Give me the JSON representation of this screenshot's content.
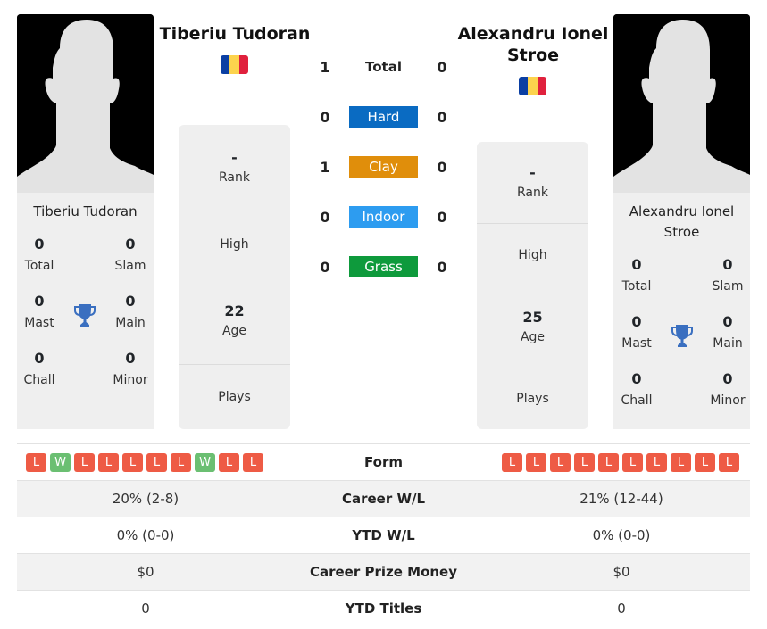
{
  "player1": {
    "name": "Tiberiu Tudoran",
    "card_name": "Tiberiu Tudoran",
    "flag_colors": [
      "#0b3fa3",
      "#fcd34d",
      "#e0213d"
    ],
    "titles": {
      "total": {
        "value": "0",
        "label": "Total"
      },
      "slam": {
        "value": "0",
        "label": "Slam"
      },
      "mast": {
        "value": "0",
        "label": "Mast"
      },
      "main": {
        "value": "0",
        "label": "Main"
      },
      "chall": {
        "value": "0",
        "label": "Chall"
      },
      "minor": {
        "value": "0",
        "label": "Minor"
      }
    },
    "info": {
      "rank": {
        "value": "-",
        "label": "Rank"
      },
      "high": {
        "value": "",
        "label": "High"
      },
      "age": {
        "value": "22",
        "label": "Age"
      },
      "plays": {
        "value": "",
        "label": "Plays"
      }
    },
    "form": [
      "L",
      "W",
      "L",
      "L",
      "L",
      "L",
      "L",
      "W",
      "L",
      "L"
    ],
    "career_wl": "20% (2-8)",
    "ytd_wl": "0% (0-0)",
    "prize_money": "$0",
    "ytd_titles": "0"
  },
  "player2": {
    "name": "Alexandru Ionel Stroe",
    "card_name": "Alexandru Ionel Stroe",
    "flag_colors": [
      "#0b3fa3",
      "#fcd34d",
      "#e0213d"
    ],
    "titles": {
      "total": {
        "value": "0",
        "label": "Total"
      },
      "slam": {
        "value": "0",
        "label": "Slam"
      },
      "mast": {
        "value": "0",
        "label": "Mast"
      },
      "main": {
        "value": "0",
        "label": "Main"
      },
      "chall": {
        "value": "0",
        "label": "Chall"
      },
      "minor": {
        "value": "0",
        "label": "Minor"
      }
    },
    "info": {
      "rank": {
        "value": "-",
        "label": "Rank"
      },
      "high": {
        "value": "",
        "label": "High"
      },
      "age": {
        "value": "25",
        "label": "Age"
      },
      "plays": {
        "value": "",
        "label": "Plays"
      }
    },
    "form": [
      "L",
      "L",
      "L",
      "L",
      "L",
      "L",
      "L",
      "L",
      "L",
      "L"
    ],
    "career_wl": "21% (12-44)",
    "ytd_wl": "0% (0-0)",
    "prize_money": "$0",
    "ytd_titles": "0"
  },
  "h2h": [
    {
      "label": "Total",
      "p1": "1",
      "p2": "0",
      "color": ""
    },
    {
      "label": "Hard",
      "p1": "0",
      "p2": "0",
      "color": "#0a6bc2"
    },
    {
      "label": "Clay",
      "p1": "1",
      "p2": "0",
      "color": "#e08e0b"
    },
    {
      "label": "Indoor",
      "p1": "0",
      "p2": "0",
      "color": "#2d9cf0"
    },
    {
      "label": "Grass",
      "p1": "0",
      "p2": "0",
      "color": "#0e9a3c"
    }
  ],
  "stats_labels": {
    "form": "Form",
    "career_wl": "Career W/L",
    "ytd_wl": "YTD W/L",
    "prize_money": "Career Prize Money",
    "ytd_titles": "YTD Titles"
  },
  "icons": {
    "trophy": "trophy-icon",
    "avatar": "player-silhouette"
  },
  "colors": {
    "loss": "#ee5b45",
    "win": "#6bbf72",
    "trophy": "#3a6fc0"
  }
}
